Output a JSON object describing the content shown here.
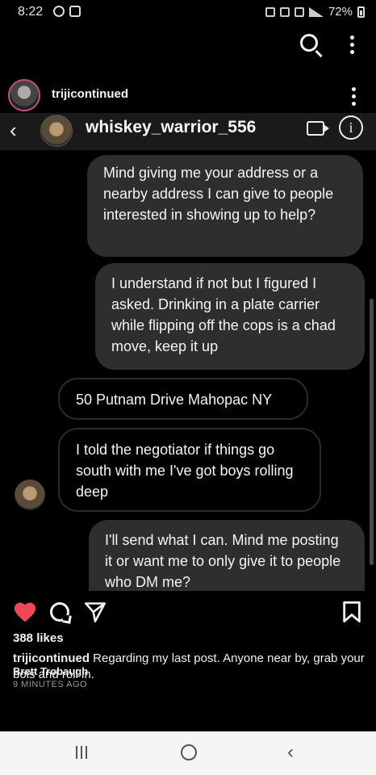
{
  "status_bar": {
    "time": "8:22",
    "battery": "72%"
  },
  "post": {
    "username": "trijicontinued",
    "likes": "388 likes",
    "caption": "Regarding my last post.  Anyone near by, grab your bois and roll in.",
    "overlay_name": "Brett Trobaugh",
    "timestamp": "9 MINUTES AGO"
  },
  "dm": {
    "username": "whiskey_warrior_556",
    "messages": [
      {
        "type": "sent",
        "text": "Mind giving me your address or a nearby address I can give to people interested in showing up to help?"
      },
      {
        "type": "sent",
        "text": "I understand if not but I figured I asked. Drinking in a plate carrier while flipping off the cops is a chad move, keep it up"
      },
      {
        "type": "received",
        "text": "50 Putnam Drive Mahopac NY"
      },
      {
        "type": "received",
        "text": "I told the negotiator if things go south with me I've got boys rolling deep"
      },
      {
        "type": "sent",
        "text": "I'll send what I can. Mind me posting it or want me to only give it to people who DM me?"
      }
    ]
  },
  "icons": {
    "search": "search-icon",
    "more": "kebab-menu-icon",
    "heart": "heart-icon",
    "comment": "comment-icon",
    "share": "paper-plane-icon",
    "save": "bookmark-icon",
    "back": "chevron-left-icon",
    "video": "video-call-icon",
    "info": "info-icon"
  },
  "colors": {
    "heart": "#ed4956",
    "background": "#000000",
    "bubble": "#2e2e2e"
  }
}
